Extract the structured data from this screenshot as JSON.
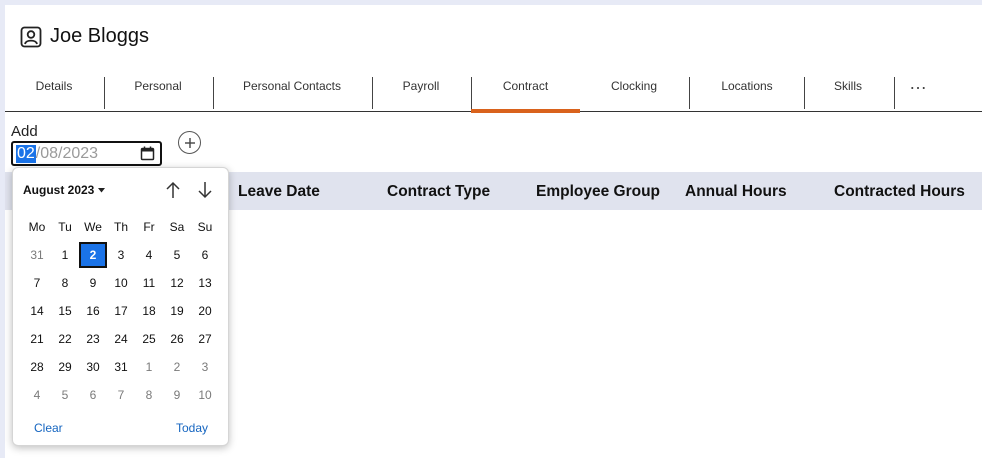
{
  "header": {
    "name": "Joe Bloggs",
    "icon": "user-portrait-icon"
  },
  "tabs": [
    {
      "label": "Details"
    },
    {
      "label": "Personal"
    },
    {
      "label": "Personal Contacts"
    },
    {
      "label": "Payroll"
    },
    {
      "label": "Contract",
      "active": true
    },
    {
      "label": "Clocking"
    },
    {
      "label": "Locations"
    },
    {
      "label": "Skills"
    }
  ],
  "more_label": "…",
  "add": {
    "label": "Add",
    "date_selected_segment": "02",
    "date_rest": "/08/2023"
  },
  "table": {
    "columns": [
      "Leave Date",
      "Contract Type",
      "Employee Group",
      "Annual Hours",
      "Contracted Hours"
    ]
  },
  "datepicker": {
    "month_label": "August 2023",
    "weekdays": [
      "Mo",
      "Tu",
      "We",
      "Th",
      "Fr",
      "Sa",
      "Su"
    ],
    "weeks": [
      [
        {
          "d": "31",
          "o": true
        },
        {
          "d": "1"
        },
        {
          "d": "2",
          "sel": true
        },
        {
          "d": "3"
        },
        {
          "d": "4"
        },
        {
          "d": "5"
        },
        {
          "d": "6"
        }
      ],
      [
        {
          "d": "7"
        },
        {
          "d": "8"
        },
        {
          "d": "9"
        },
        {
          "d": "10"
        },
        {
          "d": "11"
        },
        {
          "d": "12"
        },
        {
          "d": "13"
        }
      ],
      [
        {
          "d": "14"
        },
        {
          "d": "15"
        },
        {
          "d": "16"
        },
        {
          "d": "17"
        },
        {
          "d": "18"
        },
        {
          "d": "19"
        },
        {
          "d": "20"
        }
      ],
      [
        {
          "d": "21"
        },
        {
          "d": "22"
        },
        {
          "d": "23"
        },
        {
          "d": "24"
        },
        {
          "d": "25"
        },
        {
          "d": "26"
        },
        {
          "d": "27"
        }
      ],
      [
        {
          "d": "28"
        },
        {
          "d": "29"
        },
        {
          "d": "30"
        },
        {
          "d": "31"
        },
        {
          "d": "1",
          "o": true
        },
        {
          "d": "2",
          "o": true
        },
        {
          "d": "3",
          "o": true
        }
      ],
      [
        {
          "d": "4",
          "o": true
        },
        {
          "d": "5",
          "o": true
        },
        {
          "d": "6",
          "o": true
        },
        {
          "d": "7",
          "o": true
        },
        {
          "d": "8",
          "o": true
        },
        {
          "d": "9",
          "o": true
        },
        {
          "d": "10",
          "o": true
        }
      ]
    ],
    "clear_label": "Clear",
    "today_label": "Today"
  },
  "colors": {
    "accent": "#d9621c",
    "selected": "#1a73e8",
    "link": "#1565c0",
    "header_bg": "#e0e3ee"
  }
}
